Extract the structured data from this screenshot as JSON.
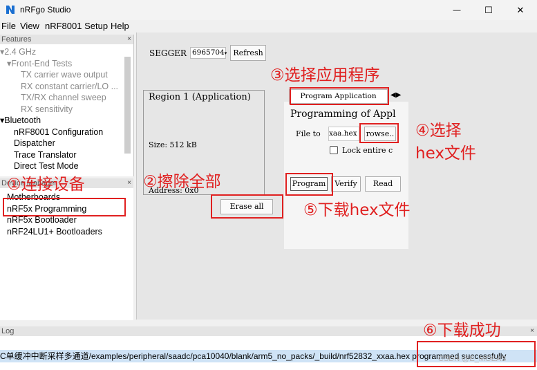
{
  "window": {
    "title": "nRFgo Studio",
    "minimize_glyph": "—",
    "maximize_glyph": "☐",
    "close_glyph": "✕"
  },
  "menu": {
    "file": "File",
    "view": "View",
    "setup": "nRF8001 Setup",
    "help": "Help"
  },
  "features": {
    "header": "Features",
    "close": "×",
    "items": [
      {
        "label": "2.4 GHz",
        "toggle": "▾"
      },
      {
        "label": "Front-End Tests",
        "toggle": "▾"
      },
      {
        "label": "TX carrier wave output"
      },
      {
        "label": "RX constant carrier/LO ..."
      },
      {
        "label": "TX/RX channel sweep"
      },
      {
        "label": "RX sensitivity"
      },
      {
        "label": "Bluetooth",
        "toggle": "▾"
      },
      {
        "label": "nRF8001 Configuration"
      },
      {
        "label": "Dispatcher"
      },
      {
        "label": "Trace Translator"
      },
      {
        "label": "Direct Test Mode"
      }
    ]
  },
  "device_manager": {
    "header": "Device Manager",
    "close": "×",
    "items": [
      {
        "label": "Motherboards"
      },
      {
        "label": "nRF5x Programming"
      },
      {
        "label": "nRF5x Bootloader"
      },
      {
        "label": "nRF24LU1+ Bootloaders"
      }
    ]
  },
  "main": {
    "segger_label": "SEGGER",
    "segger_value": "6965704",
    "refresh": "Refresh",
    "region_title": "Region 1 (Application)",
    "region_size": "Size: 512 kB",
    "region_address": "Address:  0x0",
    "erase_all": "Erase all",
    "tab_program_application": "Program Application",
    "programming_title": "Programming of Appl",
    "file_to_label": "File to",
    "file_value": "xaa.hex",
    "browse": "rowse..",
    "lock_label": "Lock entire c",
    "program": "Program",
    "verify": "Verify",
    "read": "Read"
  },
  "annotations": {
    "a1": "①连接设备",
    "a2": "②擦除全部",
    "a3": "③选择应用程序",
    "a4_line1": "④选择",
    "a4_line2": "hex文件",
    "a5": "⑤下载hex文件",
    "a6": "⑥下载成功"
  },
  "log": {
    "header": "Log",
    "close": "×",
    "line": "C单缓冲中断采样多通道/examples/peripheral/saadc/pca10040/blank/arm5_no_packs/_build/nrf52832_xxaa.hex programmed successfully",
    "watermark": "CSDN @E_MOEAS"
  },
  "colors": {
    "annotation_red": "#e02020",
    "selection_blue": "#cfe3f6",
    "app_icon_blue": "#1a6fd1"
  }
}
